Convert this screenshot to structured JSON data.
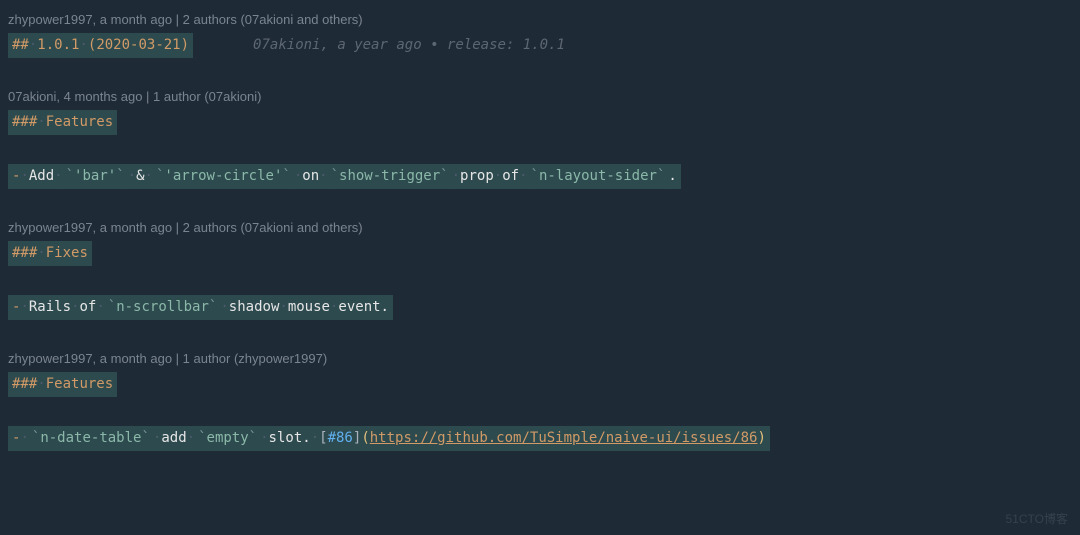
{
  "blocks": [
    {
      "blame": "zhypower1997, a month ago | 2 authors (07akioni and others)",
      "hasCursor": true,
      "heading": {
        "prefix": "##",
        "text": "1.0.1 (2020-03-21)"
      },
      "inlineBlame": {
        "author": "07akioni",
        "time": "a year ago",
        "msg": "release: 1.0.1"
      }
    },
    {
      "blame": "07akioni, 4 months ago | 1 author (07akioni)",
      "heading": {
        "prefix": "###",
        "text": "Features"
      },
      "content": {
        "type": "tokens",
        "tokens": [
          {
            "t": "list",
            "v": "-"
          },
          {
            "t": "ws",
            "v": "·"
          },
          {
            "t": "text",
            "v": "Add"
          },
          {
            "t": "ws",
            "v": "·"
          },
          {
            "t": "code",
            "v": "'bar'"
          },
          {
            "t": "ws",
            "v": "·"
          },
          {
            "t": "text",
            "v": "&"
          },
          {
            "t": "ws",
            "v": "·"
          },
          {
            "t": "code",
            "v": "'arrow-circle'"
          },
          {
            "t": "ws",
            "v": "·"
          },
          {
            "t": "text",
            "v": "on"
          },
          {
            "t": "ws",
            "v": "·"
          },
          {
            "t": "code",
            "v": "show-trigger"
          },
          {
            "t": "ws",
            "v": "·"
          },
          {
            "t": "text",
            "v": "prop"
          },
          {
            "t": "ws",
            "v": "·"
          },
          {
            "t": "text",
            "v": "of"
          },
          {
            "t": "ws",
            "v": "·"
          },
          {
            "t": "code",
            "v": "n-layout-sider"
          },
          {
            "t": "text",
            "v": "."
          }
        ]
      }
    },
    {
      "blame": "zhypower1997, a month ago | 2 authors (07akioni and others)",
      "heading": {
        "prefix": "###",
        "text": "Fixes"
      },
      "content": {
        "type": "tokens",
        "tokens": [
          {
            "t": "list",
            "v": "-"
          },
          {
            "t": "ws",
            "v": "·"
          },
          {
            "t": "text",
            "v": "Rails"
          },
          {
            "t": "ws",
            "v": "·"
          },
          {
            "t": "text",
            "v": "of"
          },
          {
            "t": "ws",
            "v": "·"
          },
          {
            "t": "code",
            "v": "n-scrollbar"
          },
          {
            "t": "ws",
            "v": "·"
          },
          {
            "t": "text",
            "v": "shadow"
          },
          {
            "t": "ws",
            "v": "·"
          },
          {
            "t": "text",
            "v": "mouse"
          },
          {
            "t": "ws",
            "v": "·"
          },
          {
            "t": "text",
            "v": "event."
          }
        ]
      }
    },
    {
      "blame": "zhypower1997, a month ago | 1 author (zhypower1997)",
      "heading": {
        "prefix": "###",
        "text": "Features"
      },
      "content": {
        "type": "tokens",
        "tokens": [
          {
            "t": "list",
            "v": "-"
          },
          {
            "t": "ws",
            "v": "·"
          },
          {
            "t": "code",
            "v": "n-date-table"
          },
          {
            "t": "ws",
            "v": "·"
          },
          {
            "t": "text",
            "v": "add"
          },
          {
            "t": "ws",
            "v": "·"
          },
          {
            "t": "code",
            "v": "empty"
          },
          {
            "t": "ws",
            "v": "·"
          },
          {
            "t": "text",
            "v": "slot."
          },
          {
            "t": "ws",
            "v": "·"
          },
          {
            "t": "link",
            "label": "#86",
            "url": "https://github.com/TuSimple/naive-ui/issues/86"
          }
        ]
      }
    }
  ],
  "watermark": "51CTO博客"
}
